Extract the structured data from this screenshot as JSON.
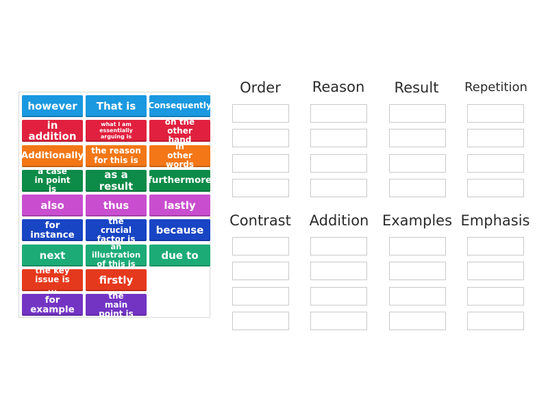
{
  "tile_bank": {
    "tiles": [
      {
        "label": "however",
        "color": "#1a98e0"
      },
      {
        "label": "That is",
        "color": "#1a98e0"
      },
      {
        "label": "Consequently",
        "color": "#1a98e0"
      },
      {
        "label": "in addition",
        "color": "#e0203e"
      },
      {
        "label": "what I am essentially arguing is",
        "color": "#e0203e"
      },
      {
        "label": "on the other hand",
        "color": "#e0203e"
      },
      {
        "label": "Additionally",
        "color": "#f37716"
      },
      {
        "label": "the reason for this is",
        "color": "#f37716"
      },
      {
        "label": "in other words",
        "color": "#f37716"
      },
      {
        "label": "a case in point is",
        "color": "#0d8b48"
      },
      {
        "label": "as a result",
        "color": "#0d8b48"
      },
      {
        "label": "furthermore",
        "color": "#0d8b48"
      },
      {
        "label": "also",
        "color": "#c94ecf"
      },
      {
        "label": "thus",
        "color": "#c94ecf"
      },
      {
        "label": "lastly",
        "color": "#c94ecf"
      },
      {
        "label": "for instance",
        "color": "#1845c4"
      },
      {
        "label": "the crucial factor is",
        "color": "#1845c4"
      },
      {
        "label": "because",
        "color": "#1845c4"
      },
      {
        "label": "next",
        "color": "#1cab77"
      },
      {
        "label": "an illustration of this is",
        "color": "#1cab77"
      },
      {
        "label": "due to",
        "color": "#1cab77"
      },
      {
        "label": "the key issue is ...",
        "color": "#e5391d"
      },
      {
        "label": "firstly",
        "color": "#e5391d"
      },
      {
        "label": "for example",
        "color": "#7334c4"
      },
      {
        "label": "the main point is",
        "color": "#7334c4"
      }
    ]
  },
  "categories": [
    {
      "title": "Order"
    },
    {
      "title": "Reason"
    },
    {
      "title": "Result"
    },
    {
      "title": "Repetition"
    },
    {
      "title": "Contrast"
    },
    {
      "title": "Addition"
    },
    {
      "title": "Examples"
    },
    {
      "title": "Emphasis"
    }
  ]
}
